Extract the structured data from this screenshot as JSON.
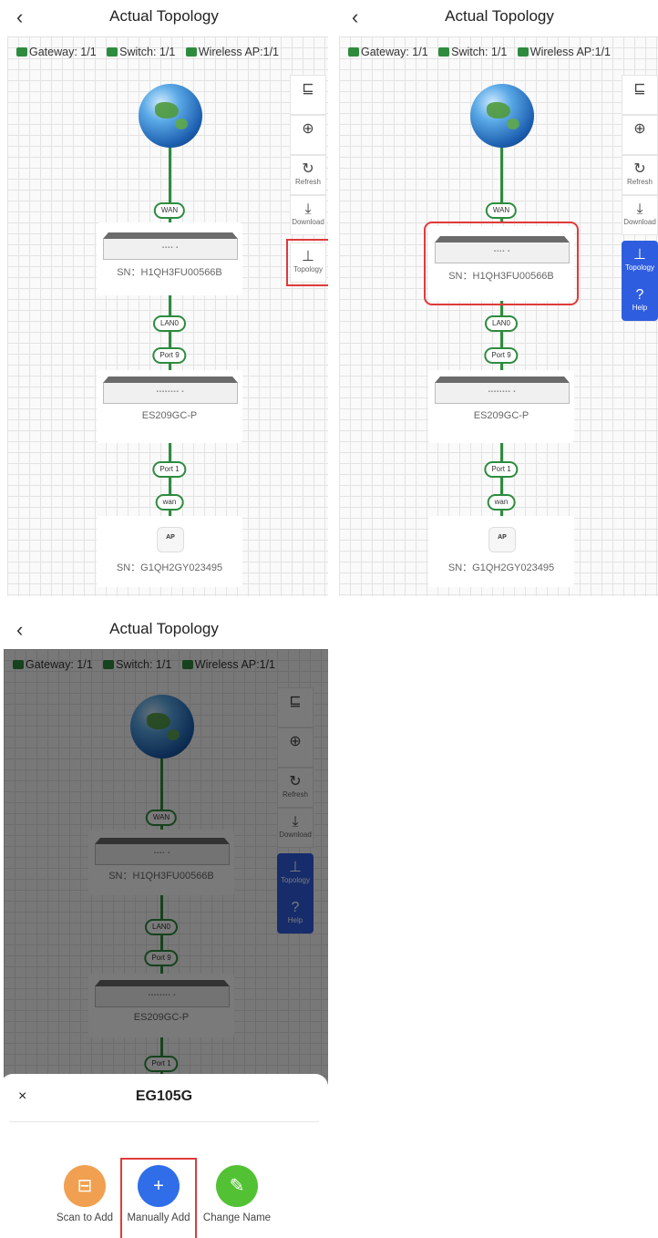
{
  "title": "Actual Topology",
  "legend": {
    "gateway": "Gateway: 1/1",
    "switch": "Switch: 1/1",
    "ap": "Wireless AP:1/1"
  },
  "toolbar": {
    "refresh": "Refresh",
    "download": "Download",
    "topology": "Topology",
    "help": "Help"
  },
  "nodes": {
    "wan": "WAN",
    "gateway_sn": "SN：H1QH3FU00566B",
    "lan0": "LAN0",
    "port9": "Port 9",
    "switch_name": "ES209GC-P",
    "port1": "Port 1",
    "ap_wan": "wan",
    "ap_badge": "AP",
    "ap_sn": "SN：G1QH2GY023495"
  },
  "sheet": {
    "title": "EG105G",
    "close": "×",
    "actions": [
      "Scan to Add",
      "Manually Add",
      "Change Name"
    ]
  },
  "colors": {
    "scan": "#f0a050",
    "manual": "#2f6ee8",
    "rename": "#52c234",
    "accent": "#2f5de0",
    "link": "#2e8b3e"
  }
}
